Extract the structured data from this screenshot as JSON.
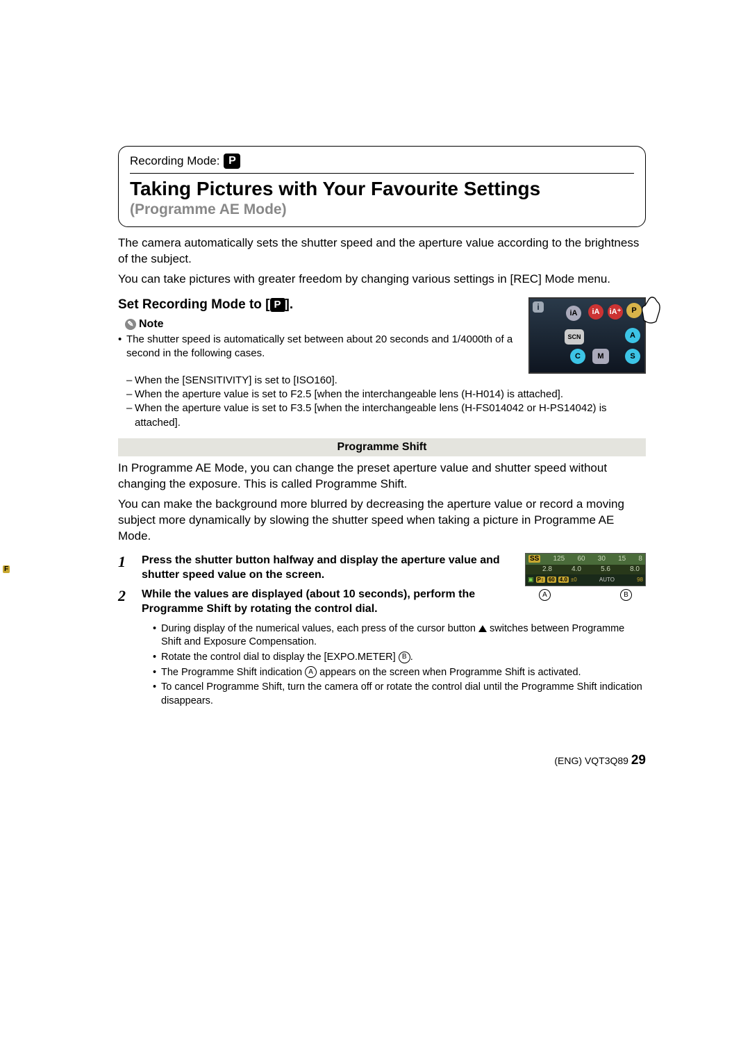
{
  "header": {
    "recording_mode_label": "Recording Mode:",
    "p_icon": "P",
    "title": "Taking Pictures with Your Favourite Settings",
    "subtitle": "(Programme AE Mode)"
  },
  "intro": {
    "p1": "The camera automatically sets the shutter speed and the aperture value according to the brightness of the subject.",
    "p2": "You can take pictures with greater freedom by changing various settings in [REC] Mode menu."
  },
  "set_instruction": {
    "prefix": "Set Recording Mode to [",
    "suffix": "]."
  },
  "note": {
    "label": "Note",
    "b1": "The shutter speed is automatically set between about 20 seconds and 1/4000th of a second in the following cases.",
    "d1": "When the [SENSITIVITY] is set to [ISO160].",
    "d2": "When the aperture value is set to F2.5 [when the interchangeable lens (H-H014) is attached].",
    "d3": "When the aperture value is set to F3.5 [when the interchangeable lens (H-FS014042 or H-PS14042) is attached]."
  },
  "shift": {
    "header": "Programme Shift",
    "p1": "In Programme AE Mode, you can change the preset aperture value and shutter speed without changing the exposure. This is called Programme Shift.",
    "p2": "You can make the background more blurred by decreasing the aperture value or record a moving subject more dynamically by slowing the shutter speed when taking a picture in Programme AE Mode."
  },
  "steps": {
    "n1": "1",
    "t1": "Press the shutter button halfway and display the aperture value and shutter speed value on the screen.",
    "n2": "2",
    "t2": "While the values are displayed (about 10 seconds), perform the Programme Shift by rotating the control dial."
  },
  "step_notes": {
    "s1a": "During display of the numerical values, each press of the cursor button ",
    "s1b": " switches between Programme Shift and Exposure Compensation.",
    "s2a": "Rotate the control dial to display the [EXPO.METER] ",
    "s2b": ".",
    "s3a": "The Programme Shift indication ",
    "s3b": " appears on the screen when Programme Shift is activated.",
    "s4": "To cancel Programme Shift, turn the camera off or rotate the control dial until the Programme Shift indication disappears."
  },
  "labels": {
    "A": "A",
    "B": "B"
  },
  "lcd": {
    "i": "i",
    "iA": "iA",
    "iAp": "iA⁺",
    "P": "P",
    "SCN": "SCN",
    "A": "A",
    "C": "C",
    "M": "M",
    "S": "S"
  },
  "expo": {
    "ss": "SS",
    "top": [
      "125",
      "60",
      "30",
      "15",
      "8"
    ],
    "mid": [
      "2.8",
      "4.0",
      "5.6",
      "8.0"
    ],
    "f_label": "F",
    "ps": "P↕",
    "val1": "60",
    "val2": "4.0",
    "ev": "±0",
    "iso": "AUTO",
    "ct": "98"
  },
  "footer": {
    "lang": "(ENG)",
    "code": "VQT3Q89",
    "page": "29"
  }
}
